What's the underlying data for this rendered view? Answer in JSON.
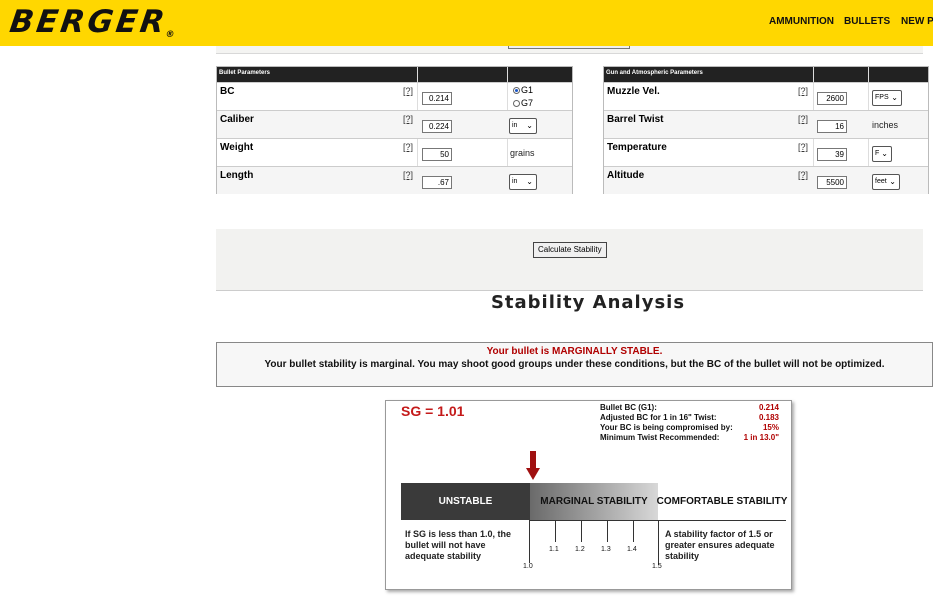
{
  "header": {
    "logo_text": "BERGER",
    "logo_mark": "®",
    "nav": [
      "AMMUNITION",
      "BULLETS",
      "NEW PRO"
    ]
  },
  "bullet_params": {
    "title": "Bullet Parameters",
    "rows": [
      {
        "label": "BC",
        "help": "[?]",
        "value": "0.214"
      },
      {
        "label": "Caliber",
        "help": "[?]",
        "value": "0.224",
        "unit_select": "in"
      },
      {
        "label": "Weight",
        "help": "[?]",
        "value": "50",
        "unit_text": "grains"
      },
      {
        "label": "Length",
        "help": "[?]",
        "value": ".67",
        "unit_select": "in"
      }
    ],
    "drag_model": {
      "options": [
        "G1",
        "G7"
      ],
      "selected": "G1"
    }
  },
  "gun_params": {
    "title": "Gun and Atmospheric Parameters",
    "rows": [
      {
        "label": "Muzzle Vel.",
        "help": "[?]",
        "value": "2600",
        "unit_select": "FPS"
      },
      {
        "label": "Barrel Twist",
        "help": "[?]",
        "value": "16",
        "unit_text": "inches"
      },
      {
        "label": "Temperature",
        "help": "[?]",
        "value": "39",
        "unit_select": "F"
      },
      {
        "label": "Altitude",
        "help": "[?]",
        "value": "5500",
        "unit_select": "feet"
      }
    ]
  },
  "calculate_label": "Calculate Stability",
  "analysis_title": "Stability Analysis",
  "result": {
    "status": "Your bullet is MARGINALLY STABLE.",
    "message": "Your bullet stability is marginal. You may shoot good groups under these conditions, but the BC of the bullet will not be optimized."
  },
  "graphic": {
    "sg_text": "SG = 1.01",
    "sg_value": 1.01,
    "stats": [
      {
        "label": "Bullet BC (G1):",
        "value": "0.214"
      },
      {
        "label": "Adjusted BC for 1 in 16\" Twist:",
        "value": "0.183"
      },
      {
        "label": "Your BC is being compromised by:",
        "value": "15%"
      },
      {
        "label": "Minimum Twist Recommended:",
        "value": "1 in 13.0\""
      }
    ],
    "bands": [
      "UNSTABLE",
      "MARGINAL STABILITY",
      "COMFORTABLE STABILITY"
    ],
    "ticks": [
      "1.0",
      "1.1",
      "1.2",
      "1.3",
      "1.4",
      "1.5"
    ],
    "note_left": "If SG is less than 1.0, the bullet will not have adequate stability",
    "note_right": "A stability factor of 1.5 or greater ensures adequate stability",
    "arrow_color": "#a01010"
  }
}
